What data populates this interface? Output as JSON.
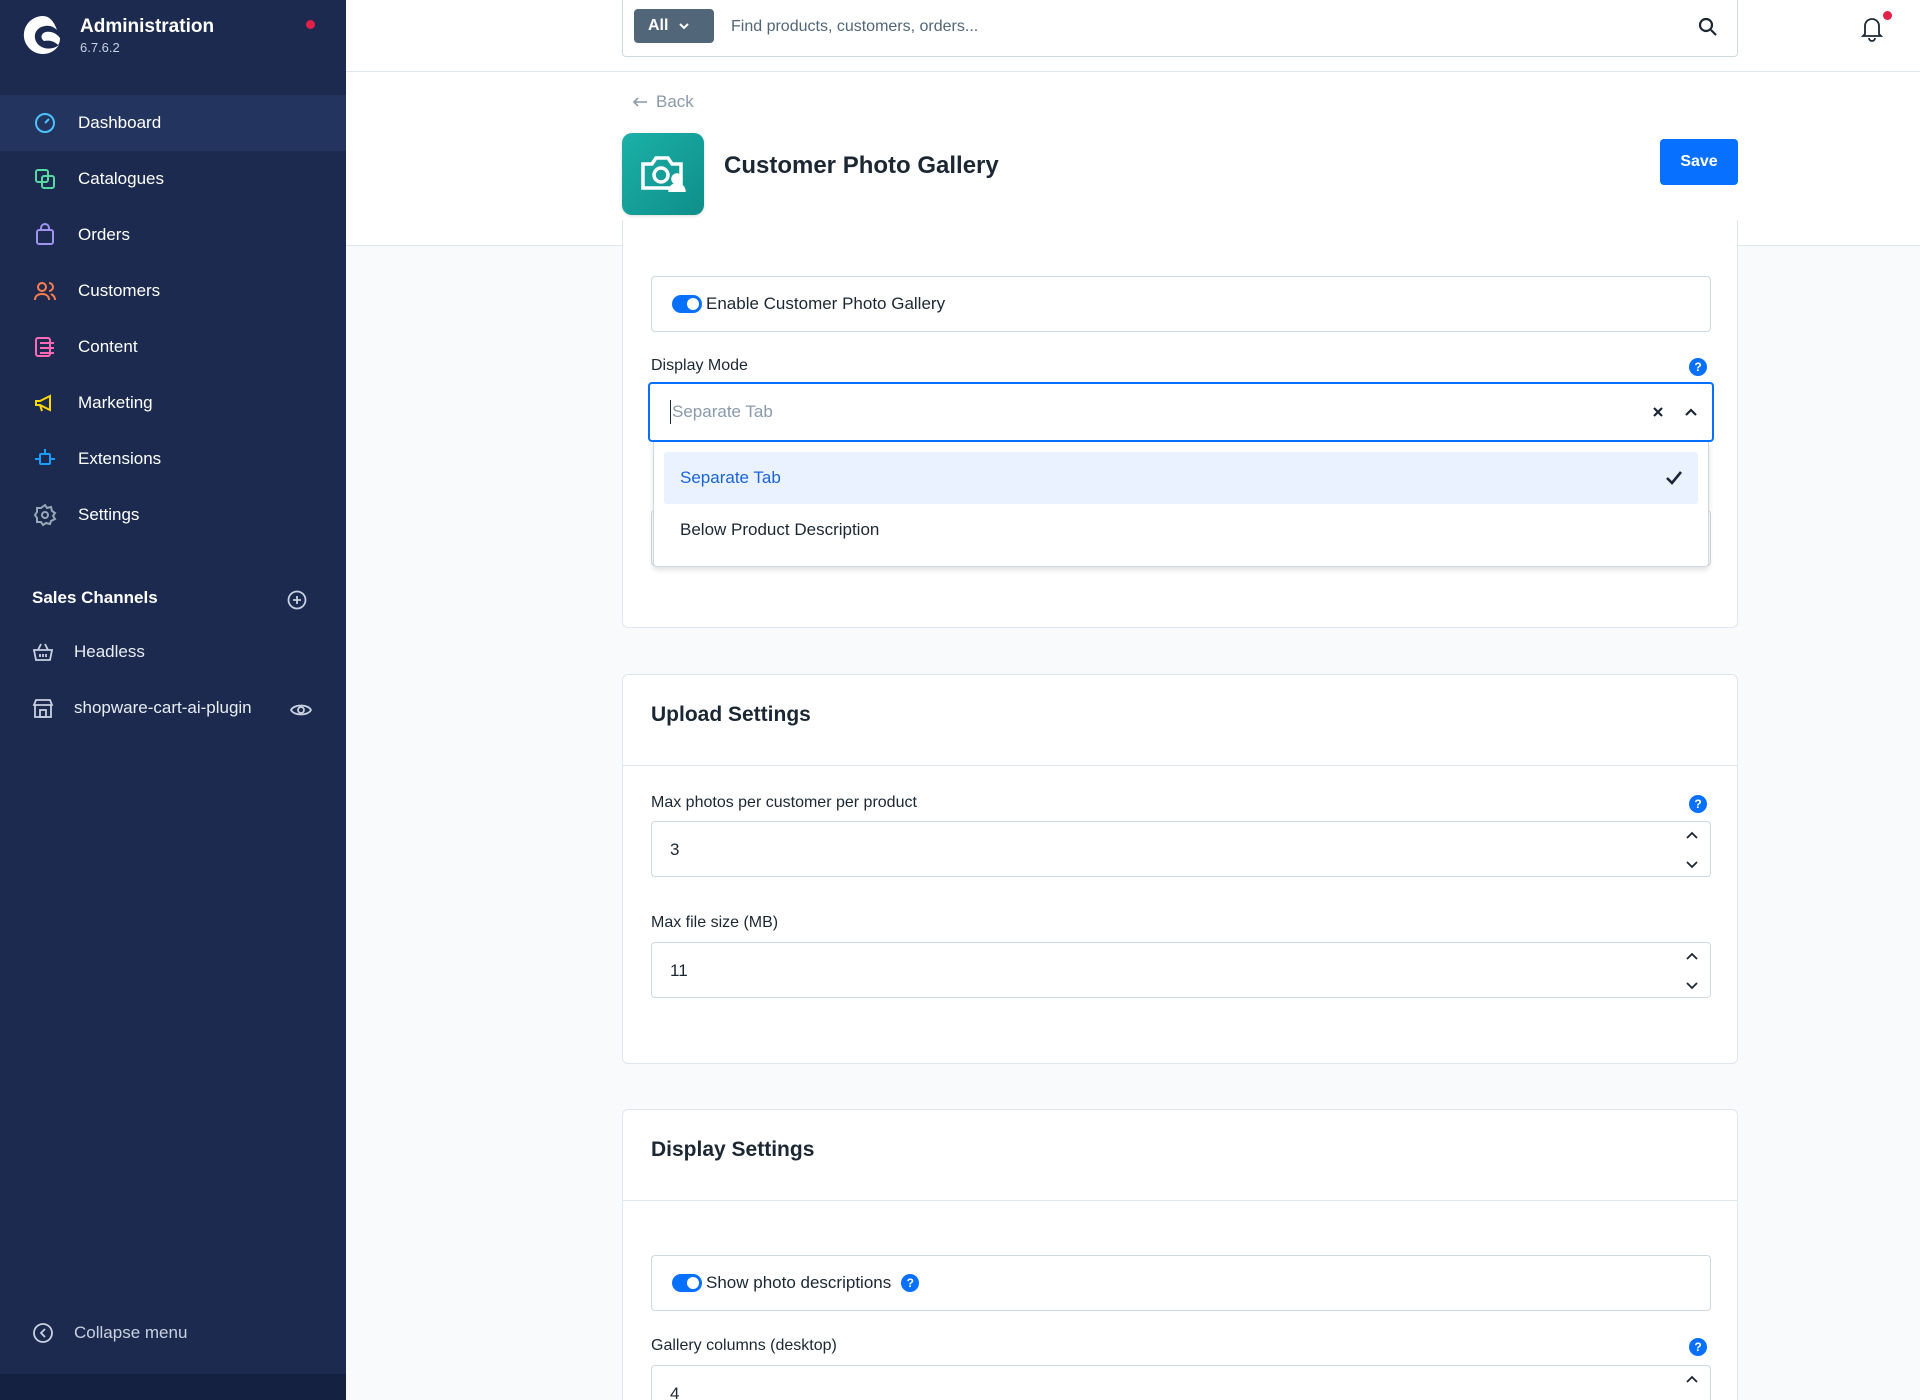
{
  "brand": {
    "name": "Administration",
    "version": "6.7.6.2"
  },
  "nav": [
    {
      "label": "Dashboard",
      "icon": "dashboard-icon",
      "color": "#4cc3ff",
      "active": true
    },
    {
      "label": "Catalogues",
      "icon": "catalogues-icon",
      "color": "#57d9a3"
    },
    {
      "label": "Orders",
      "icon": "orders-icon",
      "color": "#a092f0"
    },
    {
      "label": "Customers",
      "icon": "customers-icon",
      "color": "#ff7d4d"
    },
    {
      "label": "Content",
      "icon": "content-icon",
      "color": "#ff68b4"
    },
    {
      "label": "Marketing",
      "icon": "marketing-icon",
      "color": "#ffd700"
    },
    {
      "label": "Extensions",
      "icon": "extensions-icon",
      "color": "#189eff"
    },
    {
      "label": "Settings",
      "icon": "settings-icon",
      "color": "#9aa8b5"
    }
  ],
  "sales_channels": {
    "title": "Sales Channels",
    "items": [
      {
        "label": "Headless",
        "icon": "basket-icon"
      },
      {
        "label": "shopware-cart-ai-plugin",
        "icon": "storefront-icon"
      }
    ]
  },
  "collapse_label": "Collapse menu",
  "search": {
    "type_label": "All",
    "placeholder": "Find products, customers, orders..."
  },
  "header": {
    "back_label": "Back",
    "title": "Customer Photo Gallery",
    "save_label": "Save"
  },
  "general": {
    "enable_label": "Enable Customer Photo Gallery",
    "enabled": true,
    "display_mode_label": "Display Mode",
    "display_mode_placeholder": "Separate Tab",
    "options": [
      {
        "label": "Separate Tab",
        "selected": true
      },
      {
        "label": "Below Product Description",
        "selected": false
      }
    ]
  },
  "upload": {
    "title": "Upload Settings",
    "max_photos_label": "Max photos per customer per product",
    "max_photos_value": "3",
    "max_size_label": "Max file size (MB)",
    "max_size_value": "11"
  },
  "display": {
    "title": "Display Settings",
    "show_desc_label": "Show photo descriptions",
    "show_desc_enabled": true,
    "columns_label": "Gallery columns (desktop)",
    "columns_value": "4"
  },
  "colors": {
    "primary": "#0870ff",
    "sidebar": "#1b2a4e",
    "alert": "#e3204a"
  }
}
